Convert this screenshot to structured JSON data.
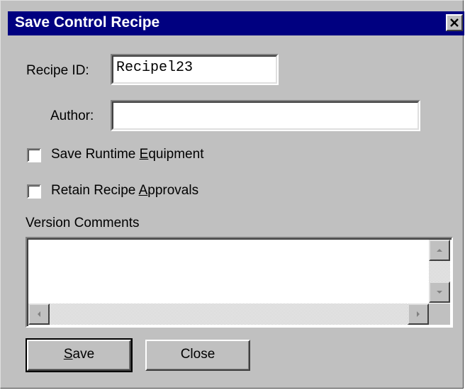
{
  "dialog": {
    "title": "Save Control Recipe"
  },
  "form": {
    "recipe_id_label": "Recipe ID:",
    "recipe_id_value": "Recipel23",
    "author_label": "Author:",
    "author_value": "",
    "save_runtime_equipment": {
      "label_pre": "Save Runtime ",
      "label_accel": "E",
      "label_post": "quipment",
      "checked": false
    },
    "retain_recipe_approvals": {
      "label_pre": "Retain Recipe ",
      "label_accel": "A",
      "label_post": "pprovals",
      "checked": false
    },
    "version_comments_label": "Version Comments",
    "version_comments_value": ""
  },
  "buttons": {
    "save_accel": "S",
    "save_rest": "ave",
    "close": "Close"
  },
  "icons": {
    "close": "close-x-icon",
    "scroll_up": "arrow-up-icon",
    "scroll_down": "arrow-down-icon",
    "scroll_left": "arrow-left-icon",
    "scroll_right": "arrow-right-icon"
  },
  "colors": {
    "title_bar": "#000080",
    "dialog_face": "#c0c0c0"
  }
}
